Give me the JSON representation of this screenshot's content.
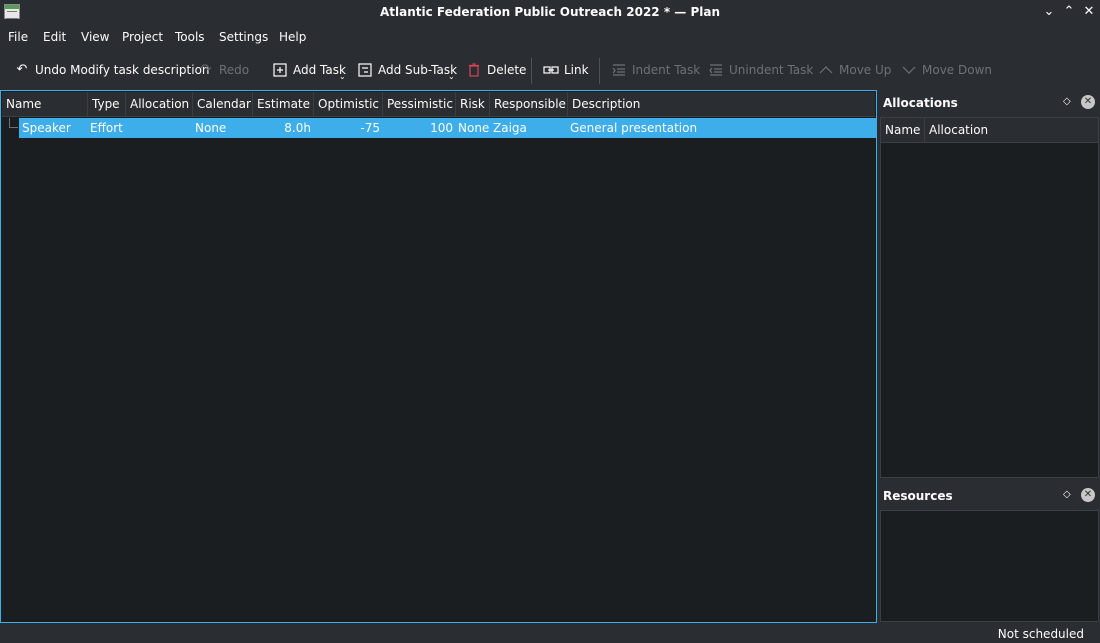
{
  "window": {
    "title": "Atlantic Federation Public Outreach 2022 * — Plan",
    "minimize_glyph": "⌄",
    "maximize_glyph": "⌃",
    "close_glyph": "✕"
  },
  "menu": {
    "file": "File",
    "edit": "Edit",
    "view": "View",
    "project": "Project",
    "tools": "Tools",
    "settings": "Settings",
    "help": "Help"
  },
  "toolbar": {
    "undo": "Undo Modify task description",
    "redo": "Redo",
    "add_task": "Add Task",
    "add_subtask": "Add Sub-Task",
    "delete": "Delete",
    "link": "Link",
    "indent": "Indent Task",
    "unindent": "Unindent Task",
    "move_up": "Move Up",
    "move_down": "Move Down"
  },
  "task_table": {
    "columns": {
      "name": "Name",
      "type": "Type",
      "allocation": "Allocation",
      "calendar": "Calendar",
      "estimate": "Estimate",
      "optimistic": "Optimistic",
      "pessimistic": "Pessimistic",
      "risk": "Risk",
      "responsible": "Responsible",
      "description": "Description"
    },
    "rows": [
      {
        "name": "Speaker",
        "type": "Effort",
        "allocation": "",
        "calendar": "None",
        "estimate": "8.0h",
        "optimistic": "-75",
        "pessimistic": "100",
        "risk": "None",
        "responsible": "Zaiga",
        "description": "General presentation"
      }
    ]
  },
  "allocations_dock": {
    "title": "Allocations",
    "col_name": "Name",
    "col_allocation": "Allocation",
    "float_glyph": "◇",
    "close_glyph": "✕"
  },
  "resources_dock": {
    "title": "Resources",
    "float_glyph": "◇",
    "close_glyph": "✕"
  },
  "status": {
    "text": "Not scheduled"
  },
  "colors": {
    "selection": "#3daee9",
    "window_bg": "#2a2e32",
    "view_bg": "#1b1e20",
    "disabled_text": "#6e7175"
  }
}
